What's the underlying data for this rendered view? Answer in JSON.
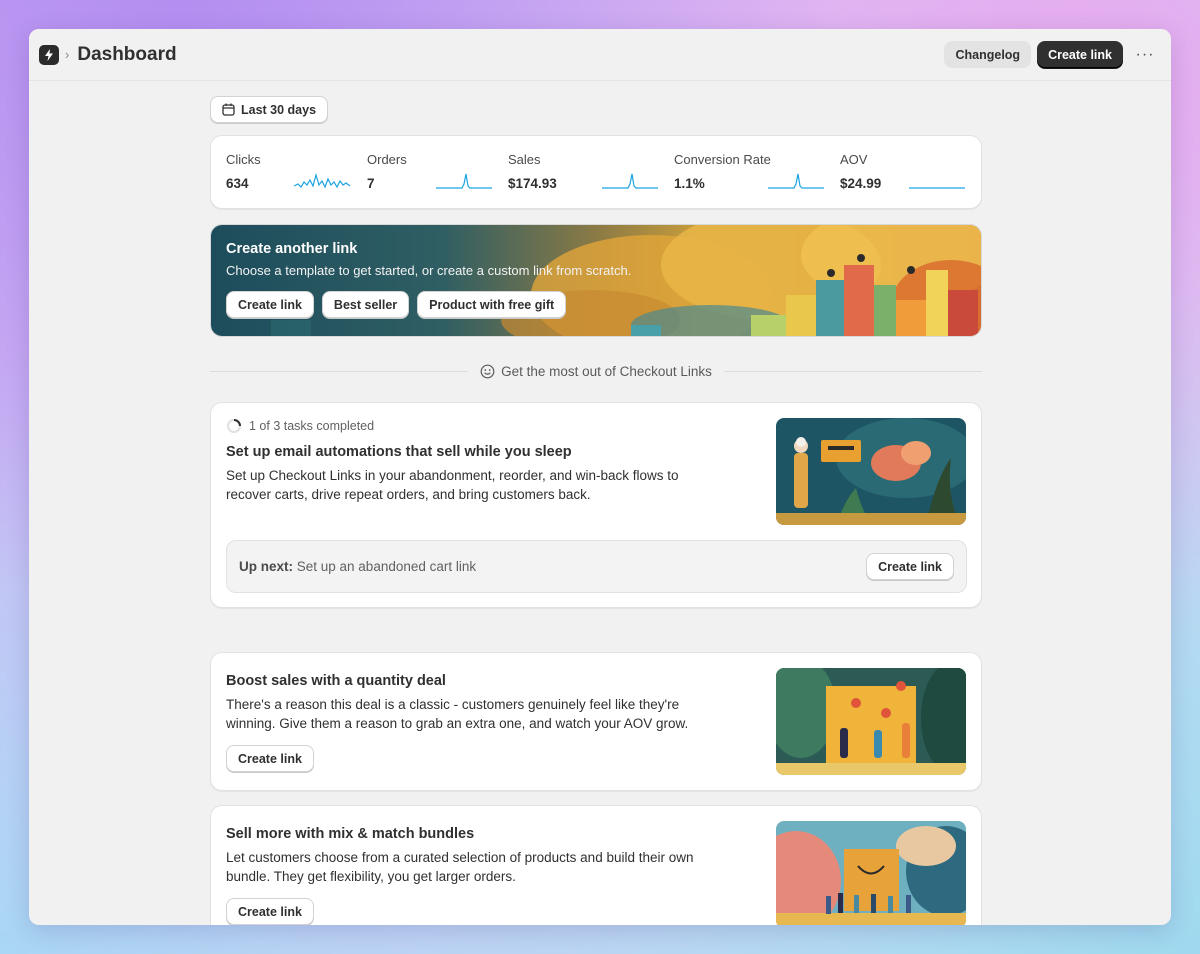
{
  "header": {
    "title": "Dashboard",
    "changelog_label": "Changelog",
    "create_link_label": "Create link",
    "more_label": "···"
  },
  "date_range": {
    "label": "Last 30 days"
  },
  "metrics": [
    {
      "label": "Clicks",
      "value": "634"
    },
    {
      "label": "Orders",
      "value": "7"
    },
    {
      "label": "Sales",
      "value": "$174.93"
    },
    {
      "label": "Conversion Rate",
      "value": "1.1%"
    },
    {
      "label": "AOV",
      "value": "$24.99"
    }
  ],
  "banner": {
    "title": "Create another link",
    "subtitle": "Choose a template to get started, or create a custom link from scratch.",
    "buttons": [
      "Create link",
      "Best seller",
      "Product with free gift"
    ]
  },
  "section_divider": {
    "text": "Get the most out of Checkout Links"
  },
  "tasks": [
    {
      "progress": "1 of 3 tasks completed",
      "title": "Set up email automations that sell while you sleep",
      "description": "Set up Checkout Links in your abandonment, reorder, and win-back flows to recover carts, drive repeat orders, and bring customers back.",
      "up_next_label": "Up next:",
      "up_next_text": " Set up an abandoned cart link",
      "button": "Create link"
    },
    {
      "title": "Boost sales with a quantity deal",
      "description": "There's a reason this deal is a classic - customers genuinely feel like they're winning. Give them a reason to grab an extra one, and watch your AOV grow.",
      "button": "Create link"
    },
    {
      "title": "Sell more with mix & match bundles",
      "description": "Let customers choose from a curated selection of products and build their own bundle. They get flexibility, you get larger orders.",
      "button": "Create link"
    }
  ],
  "colors": {
    "accent_dark": "#303030",
    "sparkline": "#1aa3e0",
    "window_bg": "#f1f1f1"
  },
  "icons": [
    "app-logo-icon",
    "chevron-right-icon",
    "calendar-icon",
    "smiley-icon",
    "progress-spinner-icon",
    "more-horizontal-icon"
  ]
}
